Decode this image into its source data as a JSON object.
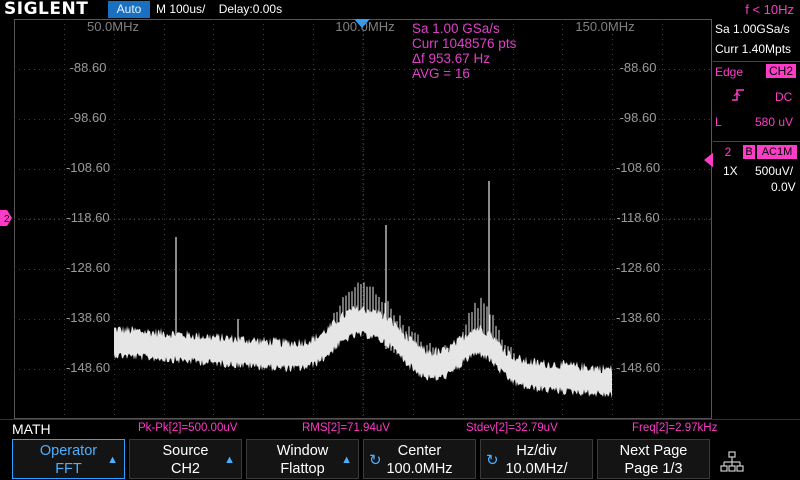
{
  "brand": "SIGLENT",
  "run_state": "Auto",
  "timebase": "M 100us/",
  "delay": "Delay:0.00s",
  "freq_counter": "f < 10Hz",
  "acquisition": {
    "sample_rate": "Sa 1.00 GSa/s",
    "current_points": "Curr 1048576 pts",
    "delta_f": "Δf 953.67 Hz",
    "avg": "AVG = 16"
  },
  "freq_labels": [
    "50.0MHz",
    "100.0MHz",
    "150.0MHz"
  ],
  "level_labels": [
    "-88.60",
    "-98.60",
    "-108.60",
    "-118.60",
    "-128.60",
    "-138.60",
    "-148.60"
  ],
  "right_panel": {
    "sample_rate": "Sa 1.00GSa/s",
    "memory_depth": "Curr 1.40Mpts",
    "trigger_type": "Edge",
    "trigger_source": "CH2",
    "trigger_coupling": "DC",
    "trigger_level_label": "L",
    "trigger_level": "580 uV",
    "channel_number": "2",
    "bw_limit": "B",
    "channel_coupling": "AC1M",
    "probe": "1X",
    "volts_div": "500uV/",
    "offset": "0.0V"
  },
  "markers": {
    "trigger_position_icon": "trigger-position-icon",
    "channel_ground_marker": "2",
    "trigger_level_icon": "trigger-level-icon"
  },
  "measurements": {
    "math_label": "MATH",
    "pk_pk": "Pk-Pk[2]=500.00uV",
    "rms": "RMS[2]=71.94uV",
    "stdev": "Stdev[2]=32.79uV",
    "freq": "Freq[2]=2.97kHz"
  },
  "softkeys": [
    {
      "line1": "Operator",
      "line2": "FFT",
      "active": true,
      "indicator": "arrow-icon"
    },
    {
      "line1": "Source",
      "line2": "CH2",
      "active": false,
      "indicator": "arrow-icon"
    },
    {
      "line1": "Window",
      "line2": "Flattop",
      "active": false,
      "indicator": "arrow-icon"
    },
    {
      "line1": "Center",
      "line2": "100.0MHz",
      "active": false,
      "indicator": "knob-icon"
    },
    {
      "line1": "Hz/div",
      "line2": "10.0MHz/",
      "active": false,
      "indicator": "knob-icon"
    },
    {
      "line1": "Next Page",
      "line2": "Page 1/3",
      "active": false,
      "indicator": ""
    }
  ],
  "colors": {
    "trace": "#e6e6e6",
    "channel": "#ff3cc8",
    "accent": "#2aa0ff",
    "grid": "#3c3c3c"
  }
}
